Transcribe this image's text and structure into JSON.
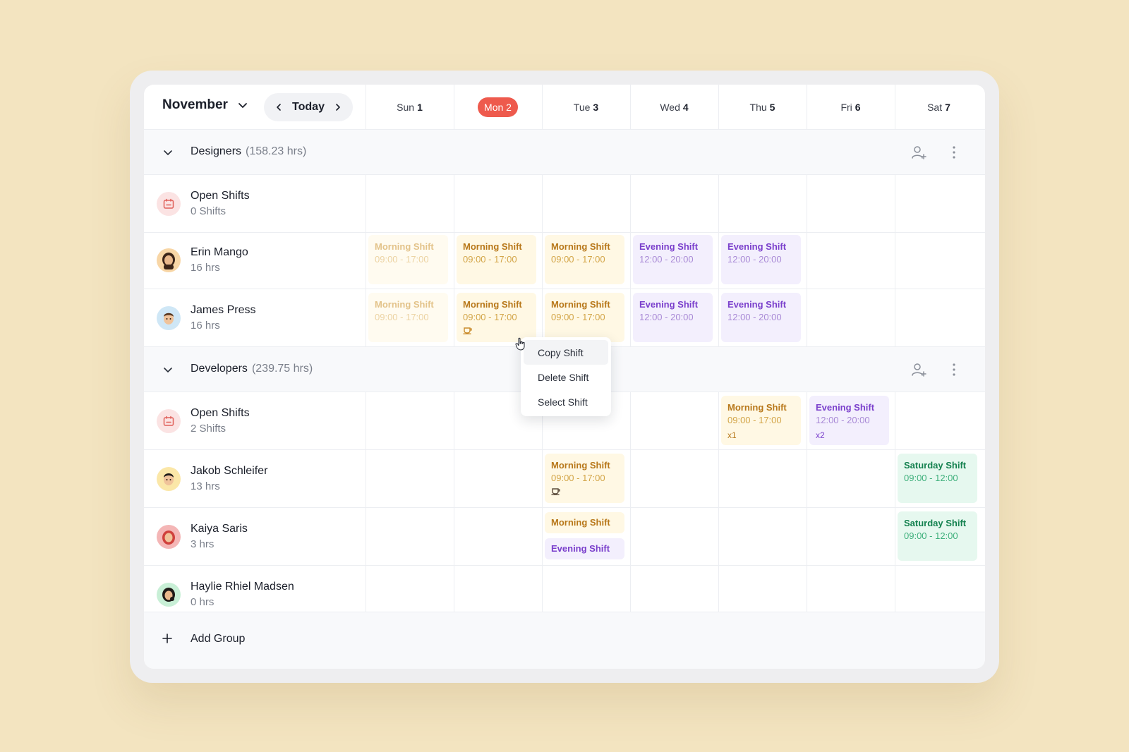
{
  "header": {
    "month": "November",
    "today_label": "Today",
    "days": [
      {
        "dow": "Sun",
        "num": "1",
        "today": false
      },
      {
        "dow": "Mon",
        "num": "2",
        "today": true
      },
      {
        "dow": "Tue",
        "num": "3",
        "today": false
      },
      {
        "dow": "Wed",
        "num": "4",
        "today": false
      },
      {
        "dow": "Thu",
        "num": "5",
        "today": false
      },
      {
        "dow": "Fri",
        "num": "6",
        "today": false
      },
      {
        "dow": "Sat",
        "num": "7",
        "today": false
      }
    ]
  },
  "groups": [
    {
      "name": "Designers",
      "hours": "(158.23 hrs)",
      "rows": [
        {
          "name": "Open Shifts",
          "sub": "0 Shifts",
          "avatar": "open-shifts-icon",
          "avatar_bg": "#fbe3e3"
        },
        {
          "name": "Erin Mango",
          "sub": "16 hrs",
          "avatar": "woman-avatar",
          "avatar_bg": "#f8d6a6"
        },
        {
          "name": "James Press",
          "sub": "16 hrs",
          "avatar": "man-avatar",
          "avatar_bg": "#cfe7f6"
        }
      ]
    },
    {
      "name": "Developers",
      "hours": "(239.75 hrs)",
      "rows": [
        {
          "name": "Open Shifts",
          "sub": "2 Shifts",
          "avatar": "open-shifts-icon",
          "avatar_bg": "#fbe3e3"
        },
        {
          "name": "Jakob Schleifer",
          "sub": "13 hrs",
          "avatar": "man-avatar",
          "avatar_bg": "#fbe7a8"
        },
        {
          "name": "Kaiya Saris",
          "sub": "3 hrs",
          "avatar": "woman-hijab-avatar",
          "avatar_bg": "#f4b6b6"
        },
        {
          "name": "Haylie Rhiel Madsen",
          "sub": "0 hrs",
          "avatar": "woman-avatar",
          "avatar_bg": "#c8efd6"
        }
      ]
    }
  ],
  "shifts": {
    "morning": {
      "title": "Morning Shift",
      "time": "09:00 - 17:00"
    },
    "evening": {
      "title": "Evening Shift",
      "time": "12:00 - 20:00"
    },
    "saturday": {
      "title": "Saturday Shift",
      "time": "09:00 - 12:00"
    },
    "open_morning_count": "x1",
    "open_evening_count": "x2"
  },
  "context_menu": {
    "items": [
      "Copy Shift",
      "Delete Shift",
      "Select Shift"
    ]
  },
  "add_group_label": "Add Group",
  "icons": {
    "month_chevron": "chevron-down-icon",
    "prev": "chevron-left-icon",
    "next": "chevron-right-icon",
    "add_person": "add-person-icon",
    "more": "more-vertical-icon",
    "break": "coffee-icon",
    "add": "plus-icon"
  },
  "colors": {
    "today_badge": "#ee5a4d",
    "morning": "#b8781a",
    "evening": "#7a3fcc",
    "saturday": "#14814f"
  }
}
